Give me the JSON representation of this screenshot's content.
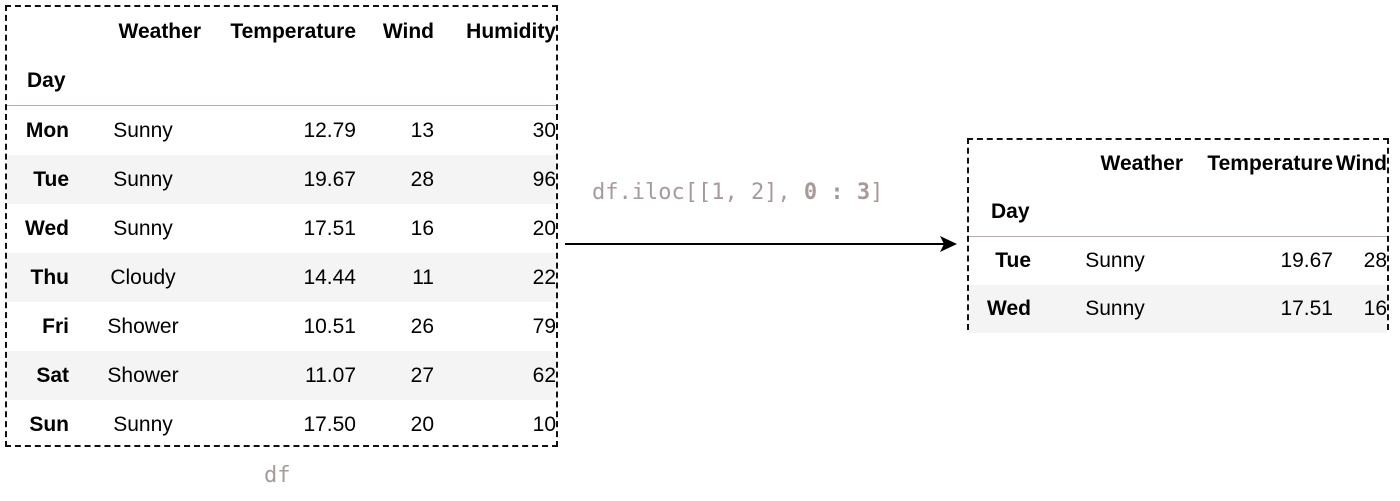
{
  "source": {
    "label": "df",
    "index_name": "Day",
    "columns": [
      "Weather",
      "Temperature",
      "Wind",
      "Humidity"
    ],
    "rows": [
      {
        "day": "Mon",
        "weather": "Sunny",
        "temperature": "12.79",
        "wind": "13",
        "humidity": "30"
      },
      {
        "day": "Tue",
        "weather": "Sunny",
        "temperature": "19.67",
        "wind": "28",
        "humidity": "96"
      },
      {
        "day": "Wed",
        "weather": "Sunny",
        "temperature": "17.51",
        "wind": "16",
        "humidity": "20"
      },
      {
        "day": "Thu",
        "weather": "Cloudy",
        "temperature": "14.44",
        "wind": "11",
        "humidity": "22"
      },
      {
        "day": "Fri",
        "weather": "Shower",
        "temperature": "10.51",
        "wind": "26",
        "humidity": "79"
      },
      {
        "day": "Sat",
        "weather": "Shower",
        "temperature": "11.07",
        "wind": "27",
        "humidity": "62"
      },
      {
        "day": "Sun",
        "weather": "Sunny",
        "temperature": "17.50",
        "wind": "20",
        "humidity": "10"
      }
    ]
  },
  "operation": {
    "prefix": "df.iloc[[1, 2], ",
    "slice_start": "0",
    "colon": " : ",
    "slice_end": "3",
    "suffix": "]"
  },
  "result": {
    "index_name": "Day",
    "columns": [
      "Weather",
      "Temperature",
      "Wind"
    ],
    "rows": [
      {
        "day": "Tue",
        "weather": "Sunny",
        "temperature": "19.67",
        "wind": "28"
      },
      {
        "day": "Wed",
        "weather": "Sunny",
        "temperature": "17.51",
        "wind": "16"
      }
    ]
  },
  "colors": {
    "border": "#111111",
    "code_text": "#a99a9a",
    "header_rule": "#b9a9a9",
    "stripe": "#f4f4f4"
  }
}
